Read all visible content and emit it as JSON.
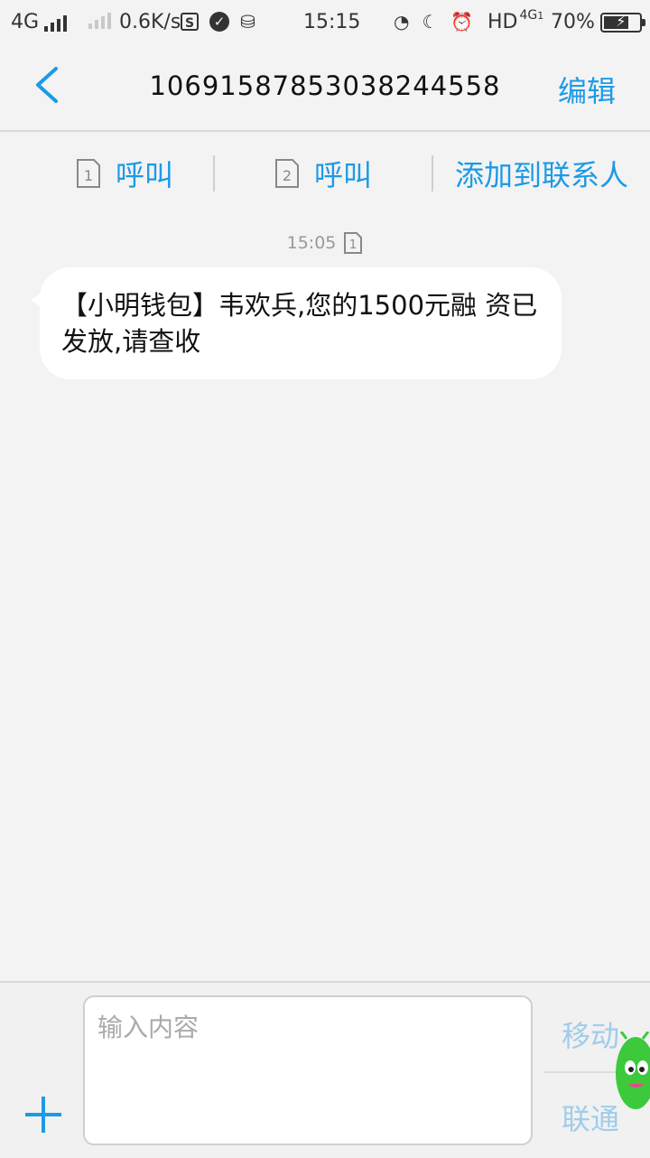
{
  "status_bar": {
    "network": "4G",
    "speed": "0.6K/s",
    "time": "15:15",
    "hd": "HD",
    "network2": "4G",
    "sim_index": "1",
    "battery": "70%",
    "battery_level": 0.7
  },
  "header": {
    "title": "10691587853038244558",
    "edit_label": "编辑"
  },
  "actions": {
    "call_sim1": {
      "sim": "1",
      "label": "呼叫"
    },
    "call_sim2": {
      "sim": "2",
      "label": "呼叫"
    },
    "add_contact": "添加到联系人"
  },
  "messages": [
    {
      "time": "15:05",
      "sim": "1",
      "text": "【小明钱包】韦欢兵,您的1500元融 资已发放,请查收"
    }
  ],
  "composer": {
    "placeholder": "输入内容",
    "send_line1": "移动",
    "send_line2": "联通"
  },
  "colors": {
    "accent": "#1d9ae6",
    "background": "#f3f3f3",
    "bubble": "#ffffff"
  }
}
